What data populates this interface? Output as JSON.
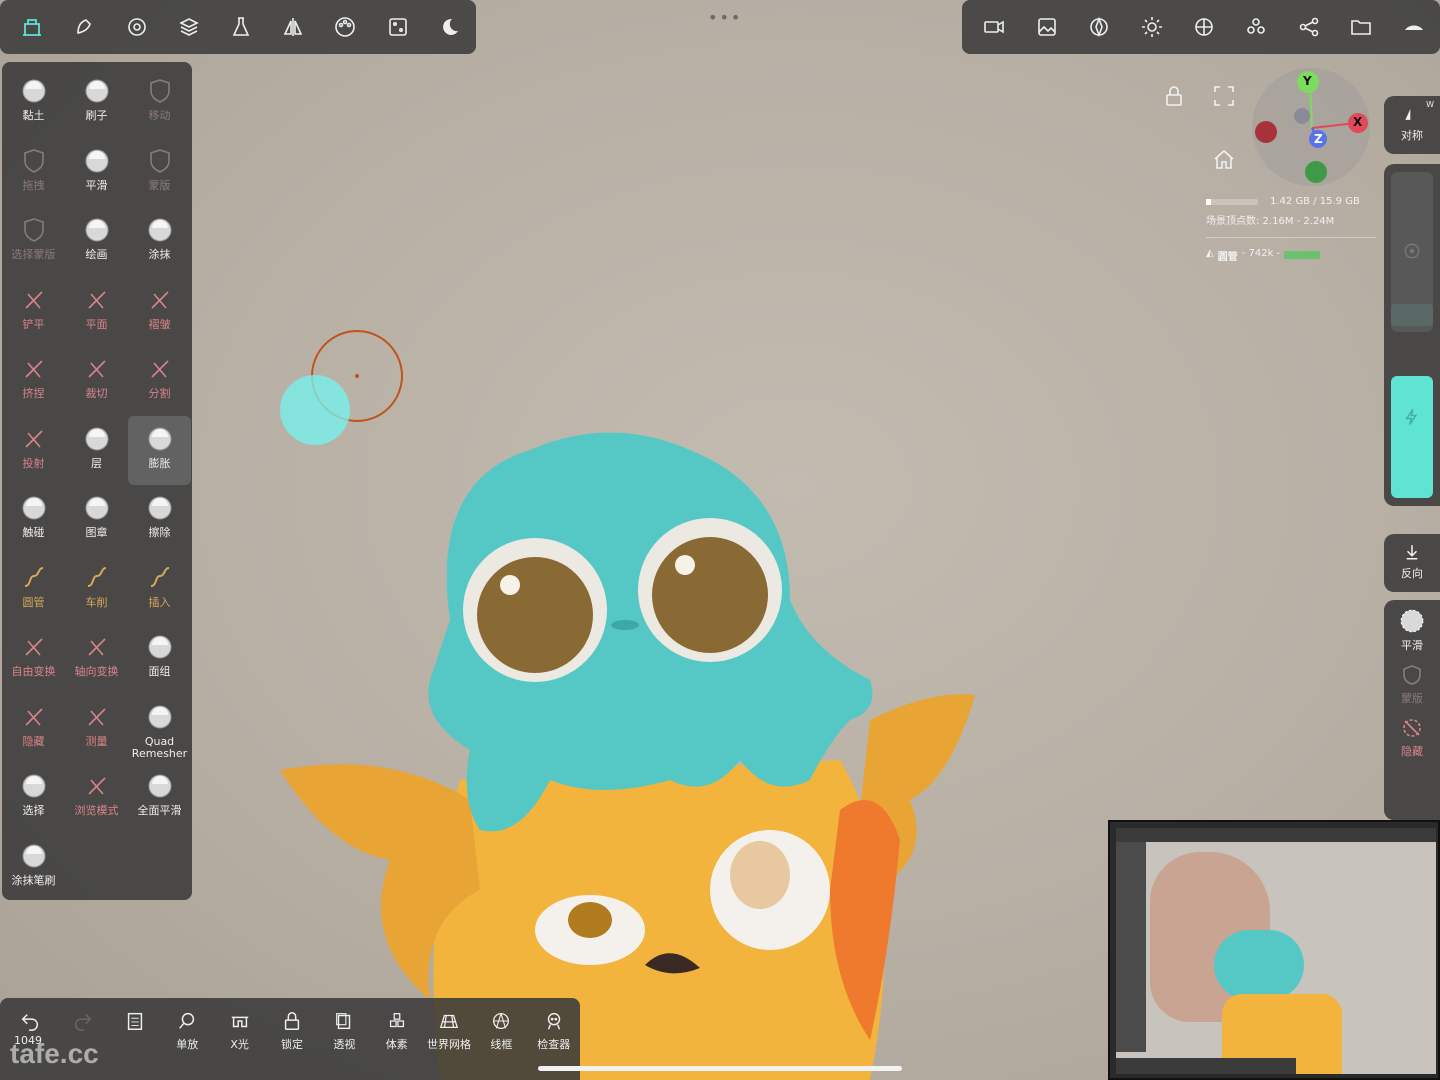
{
  "toolbar_top_left": {
    "icons": [
      "scene-icon",
      "sculpt-icon",
      "settings-icon",
      "layers-icon",
      "material-icon",
      "symmetry-icon",
      "paint-icon",
      "stroke-icon",
      "tool-settings-icon"
    ]
  },
  "toolbar_top_right": {
    "icons": [
      "camera-icon",
      "background-icon",
      "render-icon",
      "light-icon",
      "matcap-icon",
      "groups-icon",
      "share-icon",
      "folder-icon",
      "collapse-icon"
    ]
  },
  "tools": [
    {
      "label": "黏土",
      "style": "white"
    },
    {
      "label": "刷子",
      "style": "white"
    },
    {
      "label": "移动",
      "style": "dim"
    },
    {
      "label": "拖拽",
      "style": "dim"
    },
    {
      "label": "平滑",
      "style": "white"
    },
    {
      "label": "蒙版",
      "style": "dim"
    },
    {
      "label": "选择蒙版",
      "style": "dim"
    },
    {
      "label": "绘画",
      "style": "white"
    },
    {
      "label": "涂抹",
      "style": "white"
    },
    {
      "label": "铲平",
      "style": "red"
    },
    {
      "label": "平面",
      "style": "red"
    },
    {
      "label": "褶皱",
      "style": "red"
    },
    {
      "label": "挤捏",
      "style": "red"
    },
    {
      "label": "裁切",
      "style": "red"
    },
    {
      "label": "分割",
      "style": "red"
    },
    {
      "label": "投射",
      "style": "red"
    },
    {
      "label": "层",
      "style": "white"
    },
    {
      "label": "膨胀",
      "style": "white"
    },
    {
      "label": "触碰",
      "style": "white"
    },
    {
      "label": "图章",
      "style": "white"
    },
    {
      "label": "擦除",
      "style": "white"
    },
    {
      "label": "圆管",
      "style": "gold"
    },
    {
      "label": "车削",
      "style": "gold"
    },
    {
      "label": "插入",
      "style": "gold"
    },
    {
      "label": "自由变换",
      "style": "red"
    },
    {
      "label": "轴向变换",
      "style": "red"
    },
    {
      "label": "面组",
      "style": "white"
    },
    {
      "label": "隐藏",
      "style": "red"
    },
    {
      "label": "测量",
      "style": "red"
    },
    {
      "label": "Quad Remesher",
      "style": "white"
    },
    {
      "label": "选择",
      "style": "white"
    },
    {
      "label": "浏览模式",
      "style": "red"
    },
    {
      "label": "全面平滑",
      "style": "white"
    },
    {
      "label": "涂抹笔刷",
      "style": "white"
    }
  ],
  "bottom_bar": [
    {
      "label": "",
      "icon": "undo-icon"
    },
    {
      "label": "",
      "icon": "redo-icon"
    },
    {
      "label": "",
      "icon": "history-icon"
    },
    {
      "label": "单放",
      "icon": "zoom-icon"
    },
    {
      "label": "X光",
      "icon": "xray-icon"
    },
    {
      "label": "锁定",
      "icon": "lock-icon"
    },
    {
      "label": "透视",
      "icon": "perspective-icon"
    },
    {
      "label": "体素",
      "icon": "voxel-icon"
    },
    {
      "label": "世界网格",
      "icon": "grid-icon"
    },
    {
      "label": "线框",
      "icon": "wireframe-icon"
    },
    {
      "label": "检查器",
      "icon": "inspector-icon"
    }
  ],
  "undo_count": "1049",
  "watermark": "tafe.cc",
  "right_rail": {
    "symmetry_label": "对称",
    "symmetry_axis": "W",
    "invert_label": "反向",
    "smooth_label": "平滑",
    "mask_label": "蒙版",
    "hide_label": "隐藏"
  },
  "gizmo": {
    "x": "X",
    "y": "Y",
    "z": "Z"
  },
  "stats": {
    "memory": "1.42 GB / 15.9 GB",
    "vertices_line": "场景顶点数: 2.16M - 2.24M",
    "mesh_line_name": "圆管",
    "mesh_line_count": "- 742k -"
  },
  "colors": {
    "accent": "#5fe3d3",
    "panel": "#3a3a3a",
    "brush_ring": "#c0531c"
  }
}
